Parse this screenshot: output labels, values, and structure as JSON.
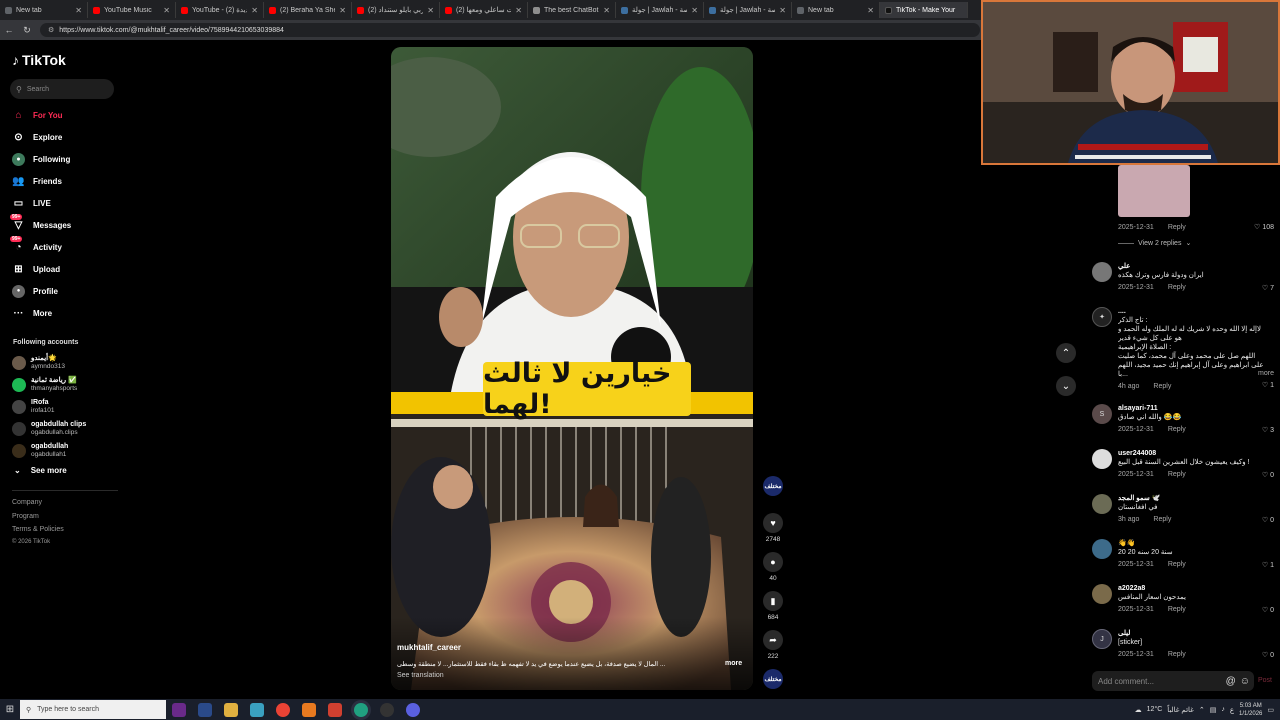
{
  "browser": {
    "tabs": [
      {
        "title": "New tab",
        "color": "#5f6368"
      },
      {
        "title": "YouTube Music",
        "color": "#ff0000"
      },
      {
        "title": "YouTube - سنة جديدة (2)",
        "color": "#ff0000"
      },
      {
        "title": "(2) Beraha Ya Sheekha",
        "color": "#ff0000"
      },
      {
        "title": "(2) عربي بايلو ستنداد",
        "color": "#ff0000"
      },
      {
        "title": "(2) ولدت ساعلي ومعها",
        "color": "#ff0000"
      },
      {
        "title": "The best ChatBot and",
        "color": "#8e8e8e"
      },
      {
        "title": "جولة | Jawlah - منصة",
        "color": "#3c6e9f"
      },
      {
        "title": "جولة | Jawlah - منصة",
        "color": "#3c6e9f"
      },
      {
        "title": "New tab",
        "color": "#5f6368"
      },
      {
        "title": "TikTok - Make Your",
        "color": "#111111"
      }
    ],
    "url": "https://www.tiktok.com/@mukhtalif_career/video/7589944210653039884"
  },
  "sidebar": {
    "logo": "TikTok",
    "search_placeholder": "Search",
    "nav": [
      {
        "label": "For You",
        "icon": "home-icon",
        "active": true
      },
      {
        "label": "Explore",
        "icon": "compass-icon"
      },
      {
        "label": "Following",
        "icon": "following-icon"
      },
      {
        "label": "Friends",
        "icon": "friends-icon"
      },
      {
        "label": "LIVE",
        "icon": "live-icon"
      },
      {
        "label": "Messages",
        "icon": "message-icon",
        "badge": "99+"
      },
      {
        "label": "Activity",
        "icon": "activity-icon",
        "badge": "99+"
      },
      {
        "label": "Upload",
        "icon": "upload-icon"
      },
      {
        "label": "Profile",
        "icon": "profile-icon"
      },
      {
        "label": "More",
        "icon": "more-icon"
      }
    ],
    "following_title": "Following accounts",
    "accounts": [
      {
        "name": "أيمندو🌟",
        "handle": "aymndo313",
        "color": "#6a5a4a"
      },
      {
        "name": "رياضة ثمانية ✅",
        "handle": "thmanyahsports",
        "color": "#1db954"
      },
      {
        "name": "IRofa",
        "handle": "irofa101",
        "color": "#444"
      },
      {
        "name": "ogabdullah clips",
        "handle": "ogabdullah.clips",
        "color": "#333"
      },
      {
        "name": "ogabdullah",
        "handle": "ogabdullah1",
        "color": "#3a2d1a"
      }
    ],
    "see_more": "See more",
    "footer": [
      "Company",
      "Program",
      "Terms & Policies",
      "© 2026 TikTok"
    ]
  },
  "video": {
    "overlay_title": "خيارين لا ثالث لهما!",
    "username": "mukhtalif_career",
    "caption": "... المال لا يضيع صدفة، بل يضيع عندما يوضع في يد لا تفهمه ظ بقاء فقط للاستثمار... لا منطقة وسطى",
    "more": "more",
    "see_translation": "See translation"
  },
  "actions": {
    "channel_badge": "مختلف",
    "likes": "2748",
    "comments": "40",
    "saves": "684",
    "shares": "222"
  },
  "comments": {
    "first_meta": {
      "date": "2025-12-31",
      "reply": "Reply",
      "likes": "108"
    },
    "view_replies": "View 2 replies",
    "items": [
      {
        "user": "علي",
        "text": "ايران ودولة فارس وترك هكذه",
        "date": "2025-12-31",
        "likes": "7",
        "avatar_color": "#777",
        "initial": ""
      },
      {
        "user": "....",
        "text": "تاج الذكر :\nلاإله إلا الله وحده لا شريك له له الملك وله الحمد و هو على كل شيء قدير\nالصلاة الإبراهيمية :\nاللهم صل على محمد وعلى آل محمد، كما صليت على ابراهيم وعلى آل إبراهيم إنك حميد مجيد، اللهم با...",
        "more": "more",
        "date": "4h ago",
        "likes": "1",
        "avatar_color": "#222",
        "initial": "✦"
      },
      {
        "user": "alsayari-711",
        "text": "والله اني صادق 😂😂",
        "date": "2025-12-31",
        "likes": "3",
        "avatar_color": "#5a4a4a",
        "initial": "S"
      },
      {
        "user": "user244008",
        "text": "وكيف يعيشون خلال العشرين السنة قبل البيع !",
        "date": "2025-12-31",
        "likes": "0",
        "avatar_color": "#ddd",
        "initial": ""
      },
      {
        "user": "سمو المجد 🕊️",
        "text": "في افغانستان",
        "date": "3h ago",
        "likes": "0",
        "avatar_color": "#6b6b55",
        "initial": ""
      },
      {
        "user": "👋👋",
        "text": "سنة 20 سنه 20 20",
        "date": "2025-12-31",
        "likes": "1",
        "avatar_color": "#3d6b8a",
        "initial": ""
      },
      {
        "user": "a2022a8",
        "text": "يمدحون اسعار المنافس",
        "date": "2025-12-31",
        "likes": "0",
        "avatar_color": "#7a6a4a",
        "initial": ""
      },
      {
        "user": "ليلى",
        "text": "[sticker]",
        "date": "2025-12-31",
        "likes": "0",
        "avatar_color": "#334",
        "initial": "J"
      }
    ],
    "add_placeholder": "Add comment...",
    "post": "Post"
  },
  "taskbar": {
    "search_placeholder": "Type here to search",
    "weather": "12°C",
    "weather_desc": "غائم غالباً",
    "time": "5:03 AM",
    "date": "1/1/2026",
    "lang": "ع"
  },
  "colors": {
    "accent": "#fe2c55",
    "cam_border": "#d9773a"
  }
}
